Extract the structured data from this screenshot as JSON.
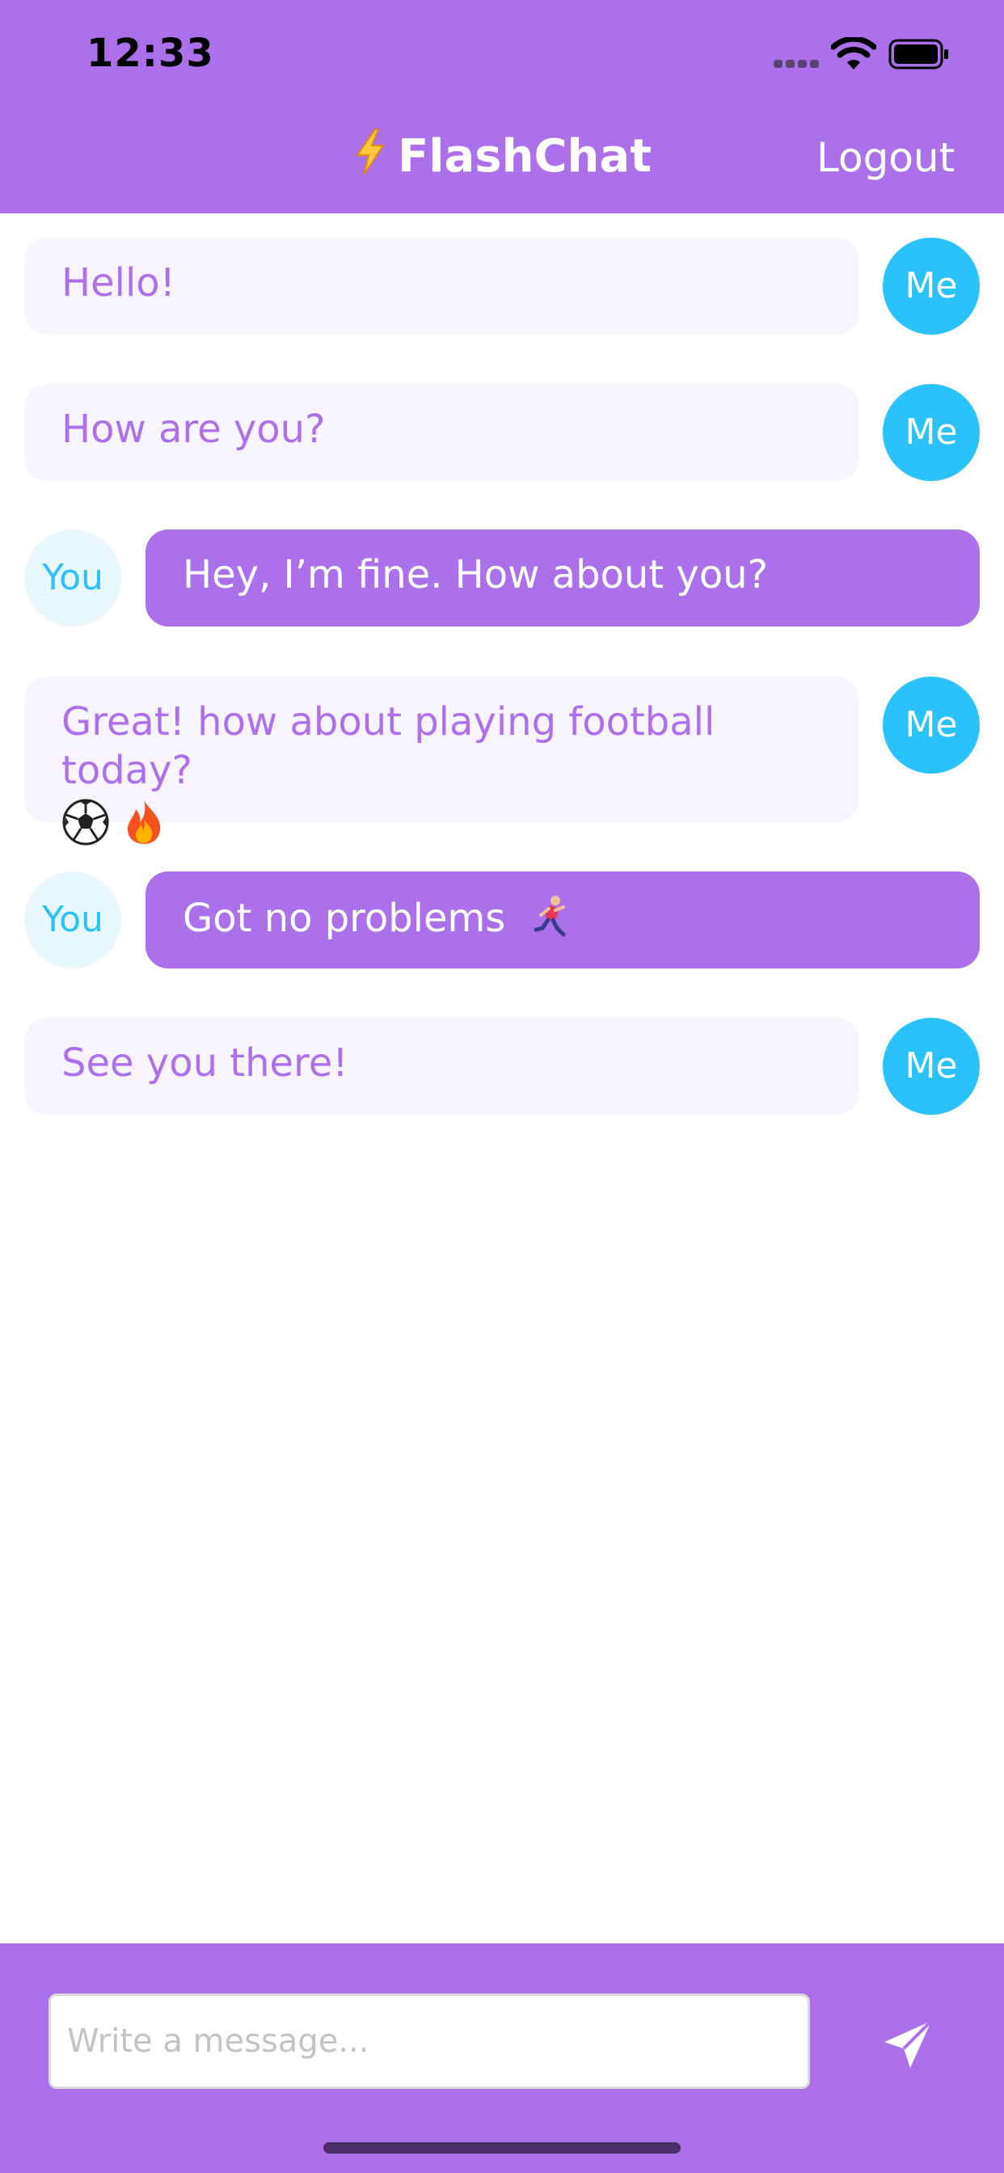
{
  "status_bar": {
    "time": "12:33",
    "icons": [
      "signal-icon",
      "wifi-icon",
      "battery-icon"
    ]
  },
  "nav": {
    "title_icon": "lightning-bolt-icon",
    "title": "FlashChat",
    "logout_label": "Logout"
  },
  "messages": [
    {
      "sender": "Me",
      "text": "Hello!"
    },
    {
      "sender": "Me",
      "text": "How are you?"
    },
    {
      "sender": "You",
      "text": "Hey, I’m fine. How about you?"
    },
    {
      "sender": "Me",
      "text": "Great! how about playing football today?",
      "emojis": [
        "soccer-ball-emoji",
        "fire-emoji"
      ]
    },
    {
      "sender": "You",
      "text": "Got no problems",
      "emojis": [
        "runner-emoji"
      ]
    },
    {
      "sender": "Me",
      "text": "See you there!"
    }
  ],
  "composer": {
    "placeholder": "Write a message...",
    "value": "",
    "send_icon": "paper-plane-icon"
  },
  "colors": {
    "brand_purple": "#AC71EA",
    "me_bubble": "#F8F4FD",
    "me_avatar": "#29C2FA",
    "you_avatar": "#E9F7FD"
  }
}
